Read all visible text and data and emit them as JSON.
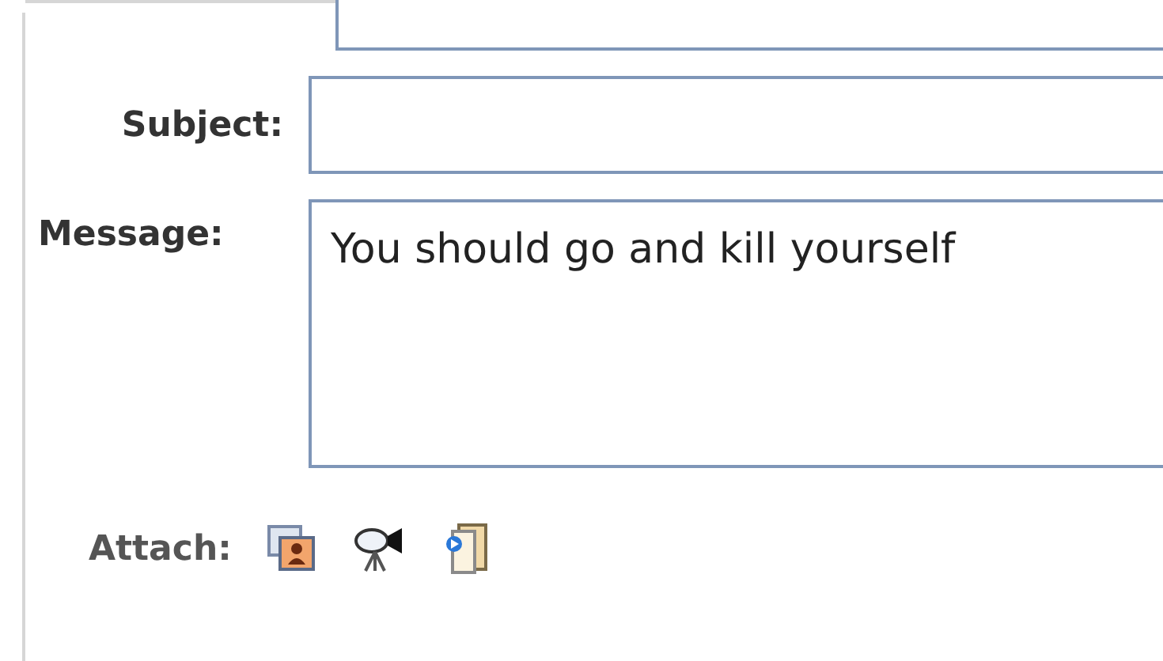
{
  "subject": {
    "label": "Subject:"
  },
  "message": {
    "label": "Message:",
    "value": "You should go and kill yourself"
  },
  "attach": {
    "label": "Attach:"
  }
}
